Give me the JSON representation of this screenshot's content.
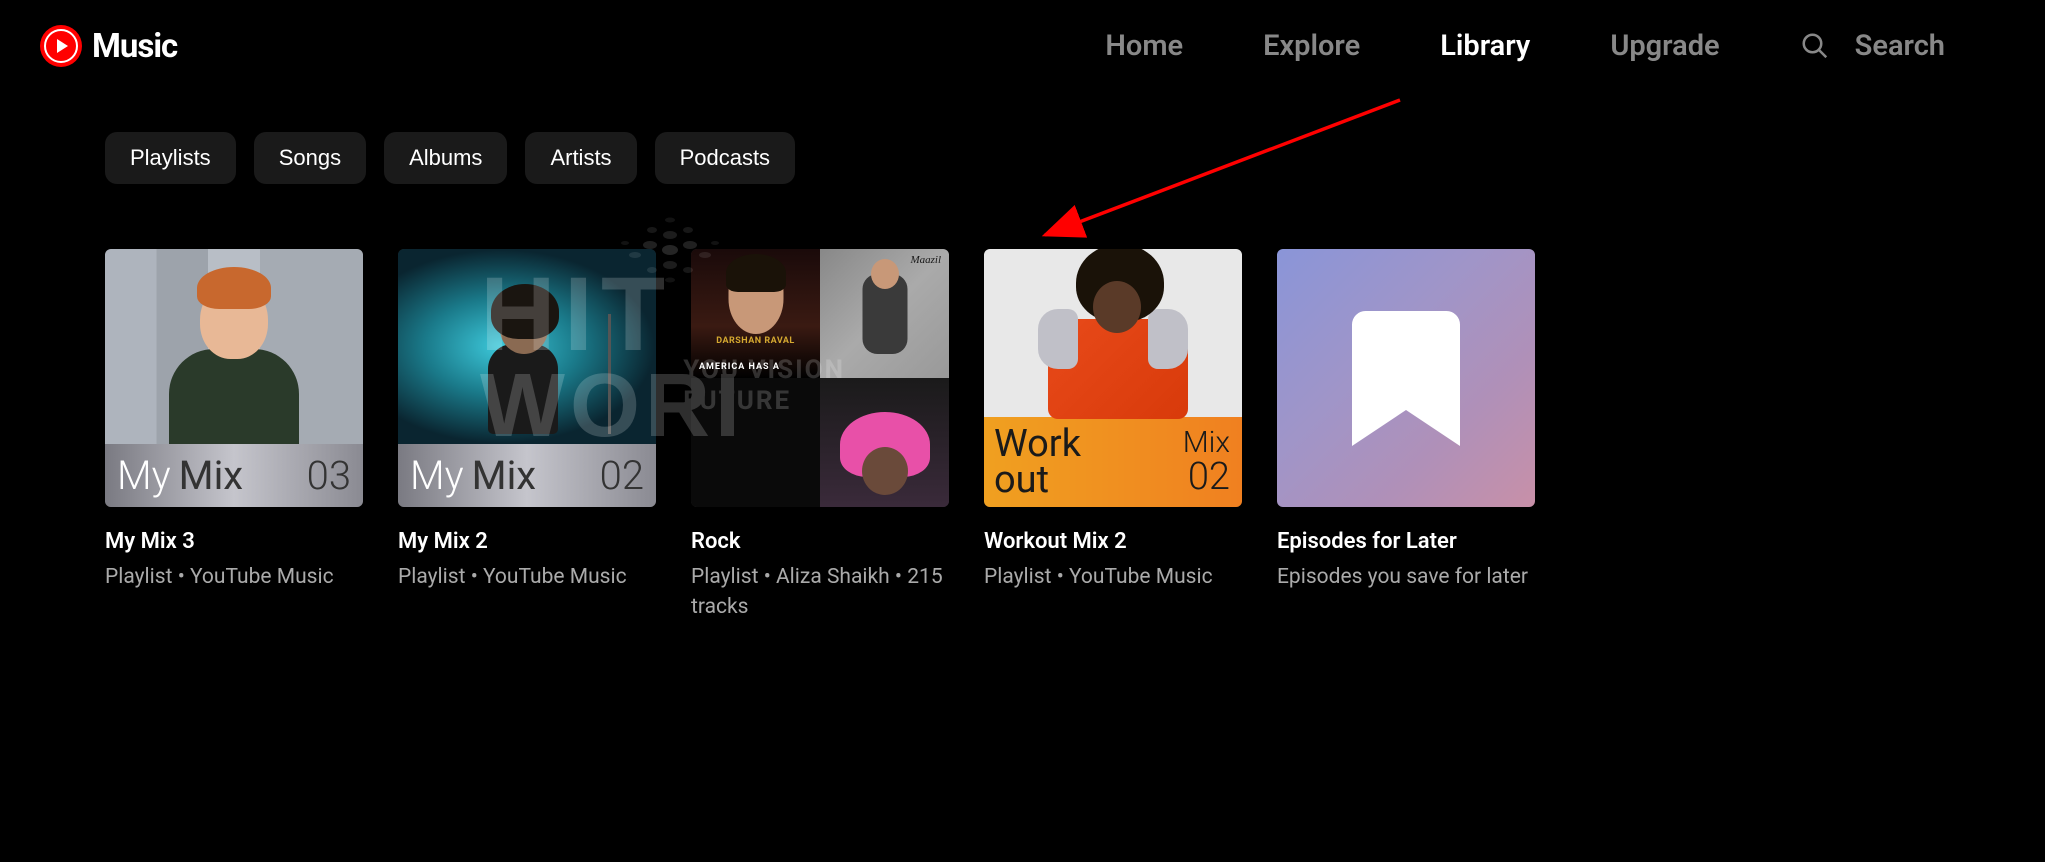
{
  "header": {
    "logo_text": "Music",
    "nav": {
      "home": "Home",
      "explore": "Explore",
      "library": "Library",
      "upgrade": "Upgrade",
      "active": "library"
    },
    "search_label": "Search"
  },
  "filters": {
    "playlists": "Playlists",
    "songs": "Songs",
    "albums": "Albums",
    "artists": "Artists",
    "podcasts": "Podcasts"
  },
  "cards": [
    {
      "title": "My Mix 3",
      "subtitle": "Playlist • YouTube Music",
      "overlay_prefix": "My",
      "overlay_word": "Mix",
      "overlay_number": "03"
    },
    {
      "title": "My Mix 2",
      "subtitle": "Playlist • YouTube Music",
      "overlay_prefix": "My",
      "overlay_word": "Mix",
      "overlay_number": "02"
    },
    {
      "title": "Rock",
      "subtitle": "Playlist • Aliza Shaikh • 215 tracks",
      "tile_text_1": "DARSHAN RAVAL",
      "tile_text_2": "AMERICA HAS A",
      "tile_text_3": "Maazil"
    },
    {
      "title": "Workout Mix 2",
      "subtitle": "Playlist • YouTube Music",
      "overlay_word_line1": "Work",
      "overlay_word_line2": "out",
      "overlay_mix": "Mix",
      "overlay_number": "02"
    },
    {
      "title": "Episodes for Later",
      "subtitle": "Episodes you save for later"
    }
  ],
  "watermark": {
    "line1": "HIT",
    "line2": "WORI",
    "sub1": "YOU VISION",
    "sub2": "FUTURE"
  }
}
